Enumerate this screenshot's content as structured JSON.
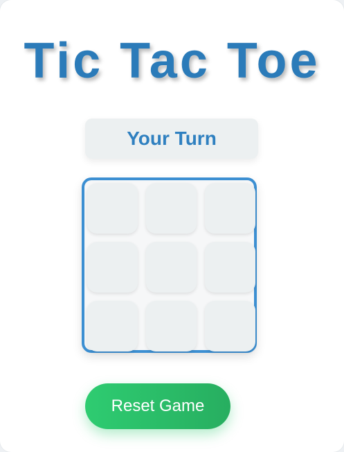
{
  "header": {
    "title": "Tic Tac Toe"
  },
  "status": {
    "text": "Your Turn"
  },
  "board": {
    "cells": [
      "",
      "",
      "",
      "",
      "",
      "",
      "",
      "",
      ""
    ]
  },
  "controls": {
    "reset_label": "Reset Game"
  },
  "colors": {
    "title": "#2b7bb9",
    "status_text": "#2f80c0",
    "board_border": "#3c8fd2",
    "cell_background": "#ecf0f1",
    "reset_start": "#2ecc71",
    "reset_end": "#27ae60"
  }
}
